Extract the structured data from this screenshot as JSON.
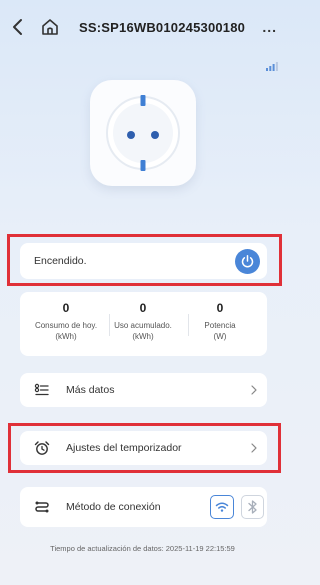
{
  "header": {
    "title": "SS:SP16WB010245300180",
    "more_label": "..."
  },
  "power": {
    "label": "Encendido.",
    "state": "on",
    "accent": "#4a86d8"
  },
  "stats": [
    {
      "value": "0",
      "label_line1": "Consumo de hoy.",
      "label_line2": "(kWh)"
    },
    {
      "value": "0",
      "label_line1": "Uso acumulado.",
      "label_line2": "(kWh)"
    },
    {
      "value": "0",
      "label_line1": "Potencia",
      "label_line2": "(W)"
    }
  ],
  "menu": {
    "more_data": {
      "label": "Más datos",
      "icon": "list-icon"
    },
    "timer": {
      "label": "Ajustes del temporizador",
      "icon": "alarm-clock-icon"
    }
  },
  "connection": {
    "label": "Método de conexión",
    "icon": "connection-icon",
    "options": [
      {
        "name": "wifi",
        "icon": "wifi-icon",
        "selected": true
      },
      {
        "name": "bluetooth",
        "icon": "bluetooth-icon",
        "selected": false
      }
    ]
  },
  "update_text": "Tiempo de actualización de datos: 2025-11-19 22:15:59",
  "highlight_color": "#e03038"
}
